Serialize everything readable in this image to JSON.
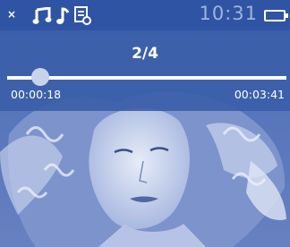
{
  "status_bar": {
    "close_glyph": "×",
    "icons": [
      "music-note-icon",
      "music-note-icon",
      "media-file-icon"
    ],
    "time": "10:31",
    "battery_icon": "battery-icon"
  },
  "player": {
    "track_counter": "2/4",
    "elapsed": "00:00:18",
    "total": "00:03:41",
    "progress_fraction": 0.081
  },
  "colors": {
    "status_bar": "#2f54a4",
    "panel": "#3a5ea8",
    "clock_text": "#9fb4dd",
    "accent": "#ffffff"
  }
}
